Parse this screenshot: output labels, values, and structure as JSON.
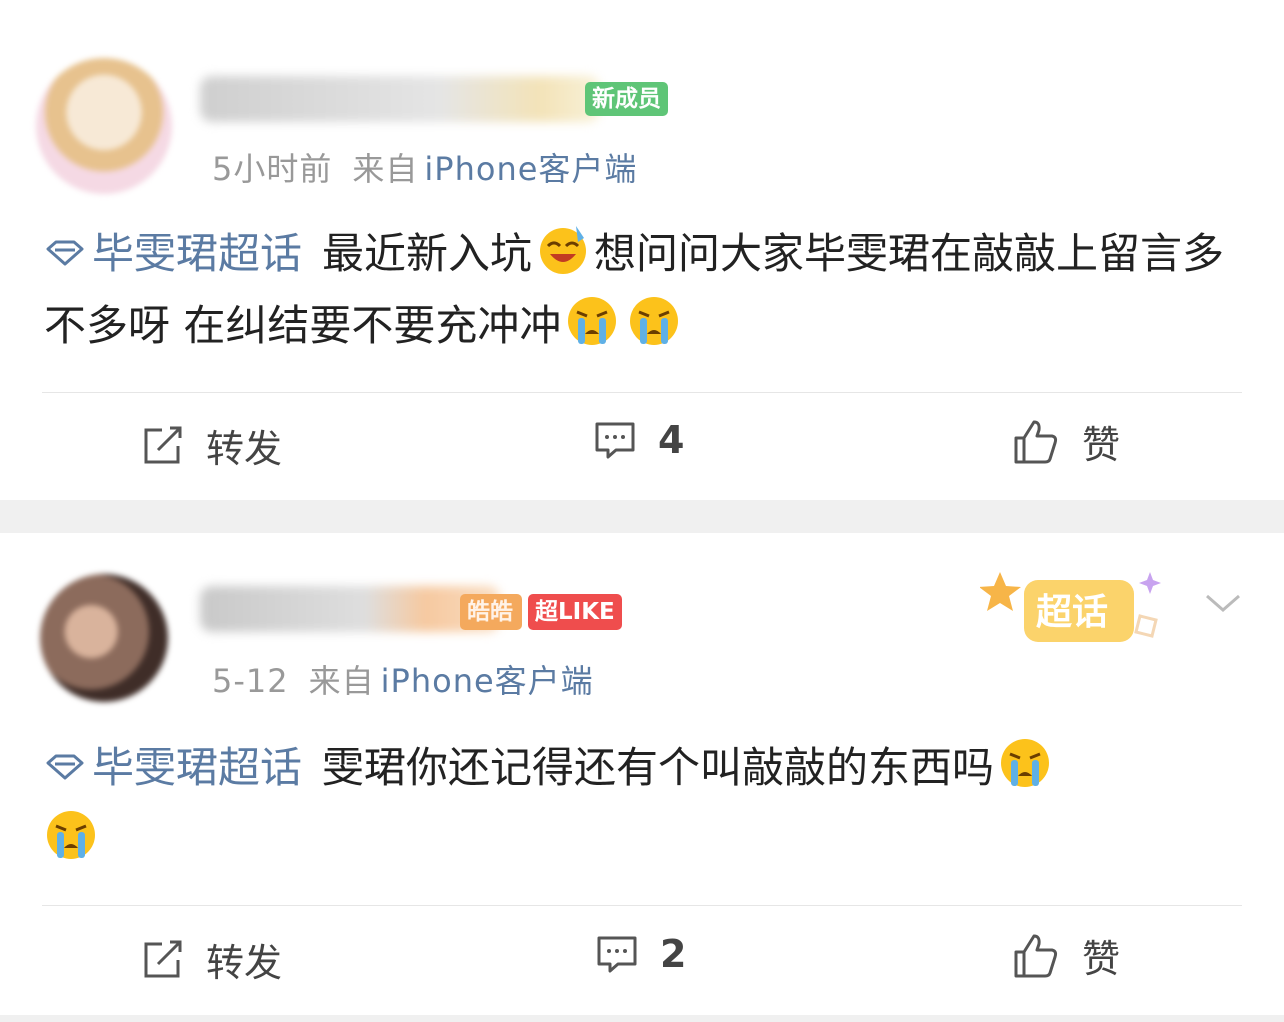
{
  "colors": {
    "topic_blue": "#5b7ba3",
    "meta_gray": "#999999",
    "new_member_green": "#5fc577",
    "super_like_red": "#ef4d4d",
    "background": "#f0f0f0"
  },
  "posts": [
    {
      "new_member_badge": "新成员",
      "time": "5小时前",
      "from": "来自",
      "source": "iPhone客户端",
      "topic": "毕雯珺超话",
      "text_a": "最近新入坑",
      "emoji_a": "laughing-crying-emoji",
      "text_b": "想问问大家毕雯珺在敲敲上留言多不多呀 在纠结要不要充冲冲",
      "trailing_emojis": [
        "crying-emoji",
        "crying-emoji"
      ],
      "actions": {
        "repost": "转发",
        "comments": "4",
        "like": "赞"
      }
    },
    {
      "gold_badge": "皓皓",
      "super_like_badge": "超LIKE",
      "super_topic_deco": "超话",
      "time": "5-12",
      "from": "来自",
      "source": "iPhone客户端",
      "topic": "毕雯珺超话",
      "text": "雯珺你还记得还有个叫敲敲的东西吗",
      "trailing_emojis": [
        "crying-emoji",
        "crying-emoji"
      ],
      "actions": {
        "repost": "转发",
        "comments": "2",
        "like": "赞"
      }
    }
  ],
  "top_deco": "超话"
}
